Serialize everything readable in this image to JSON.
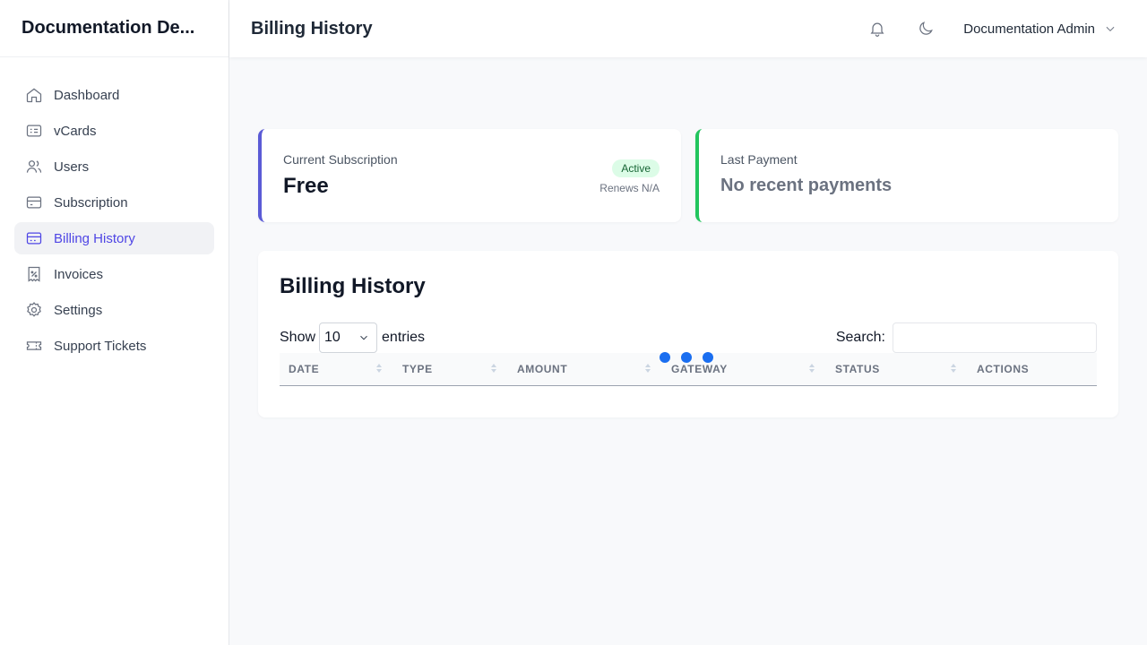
{
  "app": {
    "brand": "Documentation De..."
  },
  "sidebar": {
    "items": [
      {
        "label": "Dashboard",
        "icon": "home-icon"
      },
      {
        "label": "vCards",
        "icon": "id-card-icon"
      },
      {
        "label": "Users",
        "icon": "users-icon"
      },
      {
        "label": "Subscription",
        "icon": "card-icon"
      },
      {
        "label": "Billing History",
        "icon": "billing-icon",
        "active": true
      },
      {
        "label": "Invoices",
        "icon": "receipt-icon"
      },
      {
        "label": "Settings",
        "icon": "gear-icon"
      },
      {
        "label": "Support Tickets",
        "icon": "ticket-icon"
      }
    ]
  },
  "header": {
    "title": "Billing History",
    "user_name": "Documentation Admin",
    "icons": [
      "bell-icon",
      "moon-icon",
      "chevron-down-icon"
    ]
  },
  "subscription_card": {
    "label": "Current Subscription",
    "plan": "Free",
    "status": "Active",
    "renews": "Renews N/A",
    "accent": "#5b5bd6"
  },
  "payment_card": {
    "label": "Last Payment",
    "value": "No recent payments",
    "accent": "#22c55e"
  },
  "billing": {
    "title": "Billing History",
    "show_label": "Show",
    "entries_value": "10",
    "entries_label": "entries",
    "search_label": "Search:",
    "search_value": "",
    "columns": [
      "DATE",
      "TYPE",
      "AMOUNT",
      "GATEWAY",
      "STATUS",
      "ACTIONS"
    ]
  },
  "colors": {
    "loader": "#1a6ef0",
    "active_nav": "#4f46e5"
  }
}
